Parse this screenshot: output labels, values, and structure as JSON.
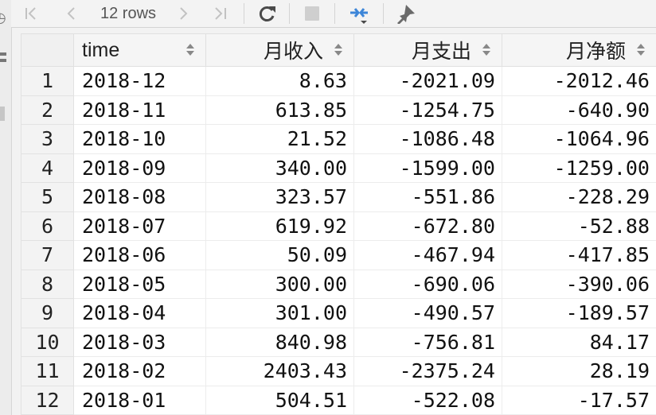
{
  "toolbar": {
    "first_icon": "|<",
    "prev_icon": "<",
    "rows_label": "12 rows",
    "next_icon": ">",
    "last_icon": ">|"
  },
  "columns": [
    "time",
    "月收入",
    "月支出",
    "月净额"
  ],
  "rows": [
    {
      "n": "1",
      "time": "2018-12",
      "income": "8.63",
      "expense": "-2021.09",
      "net": "-2012.46"
    },
    {
      "n": "2",
      "time": "2018-11",
      "income": "613.85",
      "expense": "-1254.75",
      "net": "-640.90"
    },
    {
      "n": "3",
      "time": "2018-10",
      "income": "21.52",
      "expense": "-1086.48",
      "net": "-1064.96"
    },
    {
      "n": "4",
      "time": "2018-09",
      "income": "340.00",
      "expense": "-1599.00",
      "net": "-1259.00"
    },
    {
      "n": "5",
      "time": "2018-08",
      "income": "323.57",
      "expense": "-551.86",
      "net": "-228.29"
    },
    {
      "n": "6",
      "time": "2018-07",
      "income": "619.92",
      "expense": "-672.80",
      "net": "-52.88"
    },
    {
      "n": "7",
      "time": "2018-06",
      "income": "50.09",
      "expense": "-467.94",
      "net": "-417.85"
    },
    {
      "n": "8",
      "time": "2018-05",
      "income": "300.00",
      "expense": "-690.06",
      "net": "-390.06"
    },
    {
      "n": "9",
      "time": "2018-04",
      "income": "301.00",
      "expense": "-490.57",
      "net": "-189.57"
    },
    {
      "n": "10",
      "time": "2018-03",
      "income": "840.98",
      "expense": "-756.81",
      "net": "84.17"
    },
    {
      "n": "11",
      "time": "2018-02",
      "income": "2403.43",
      "expense": "-2375.24",
      "net": "28.19"
    },
    {
      "n": "12",
      "time": "2018-01",
      "income": "504.51",
      "expense": "-522.08",
      "net": "-17.57"
    }
  ],
  "icons": {
    "refresh": "refresh-icon",
    "stop": "stop-icon",
    "compare": "compare-icon",
    "pin": "pin-icon"
  },
  "colors": {
    "accent": "#3d86d8",
    "header_bg": "#f5f5f5",
    "grid_bg": "#ffffff"
  }
}
